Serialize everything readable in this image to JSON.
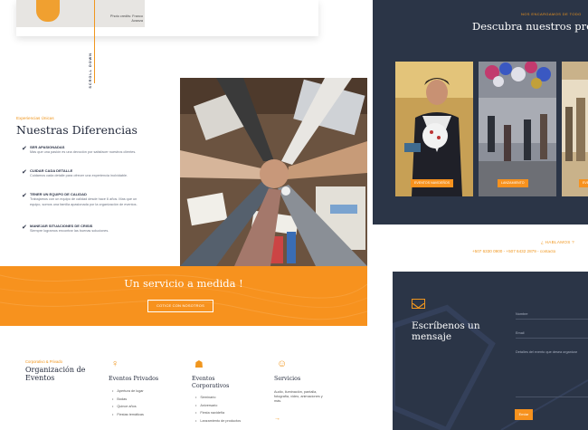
{
  "top": {
    "photo_credit": "Photo credits: Franco Avanza",
    "vertical_text": "SCROLL DOWN"
  },
  "differences": {
    "kicker": "Experiencias Únicas",
    "title": "Nuestras Diferencias",
    "items": [
      {
        "title": "SER APASIONADAS",
        "desc": "Más que una pasión es una devoción por satisfacer nuestros clientes."
      },
      {
        "title": "CUIDAR CADA DETALLE",
        "desc": "Cuidamos cada detalle para ofrecer una experiencia inolvidable."
      },
      {
        "title": "TENER UN EQUIPO DE CALIDAD",
        "desc": "Trabajamos con un equipo de calidad desde hace 6 años. Mas que un equipo, somos una familia apasionada por la organización de eventos."
      },
      {
        "title": "MANEJAR SITUACIONES DE CRISIS",
        "desc": "Siempre logramos encontrar las buenas soluciones."
      }
    ]
  },
  "band": {
    "title": "Un servicio a medida !",
    "button": "COTICE CON NOSOTROS"
  },
  "services": {
    "kicker": "Corporativo & Privado",
    "title": "Organización de Eventos",
    "columns": [
      {
        "icon": "balloon-icon",
        "title": "Eventos Privados",
        "items": [
          "Apertura de lugar",
          "Bodas",
          "Quince años",
          "Fiestas temáticas"
        ]
      },
      {
        "icon": "award-icon",
        "title": "Eventos Corporativos",
        "items": [
          "Seminario",
          "Aniversario",
          "Fiesta navideña",
          "Lanzamiento de productos"
        ]
      },
      {
        "icon": "people-icon",
        "title": "Servicios",
        "text": "Audio, iluminación, pantalla, fotografía, video, animaciones y más."
      }
    ]
  },
  "gallery": {
    "kicker": "NOS ENCARGAMOS DE TODO",
    "title": "Descubra nuestros prev",
    "tiles": [
      {
        "label": "EVENTOS NAVIDEÑOS"
      },
      {
        "label": "LANZAMIENTO"
      },
      {
        "label": "EVE"
      }
    ]
  },
  "contact": {
    "kicker": "¿ HABLAMOS ?",
    "line": "+507 6330 0900 - +507 6432 2879 - contacto",
    "form_title": "Escríbenos un mensaje",
    "fields": {
      "name": "Nombre",
      "email": "Email",
      "details": "Detalles del evento que desea organizar"
    },
    "send": "Enviar"
  },
  "colors": {
    "accent": "#f7921e",
    "dark": "#2b3547"
  }
}
